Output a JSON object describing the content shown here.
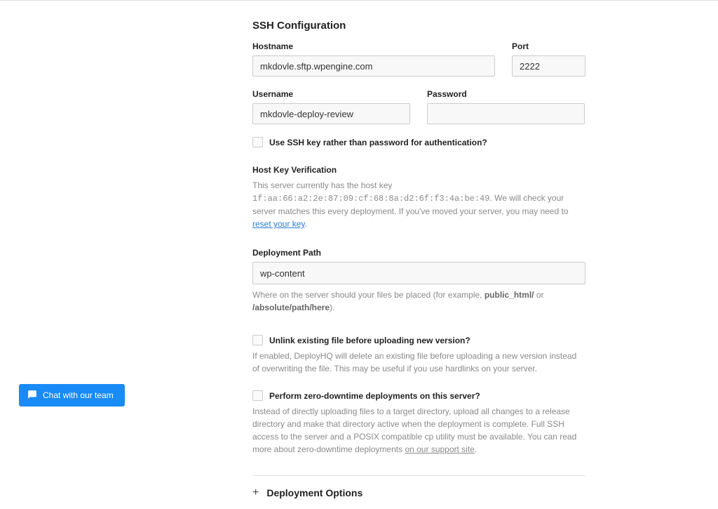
{
  "section": {
    "heading": "SSH Configuration"
  },
  "hostname": {
    "label": "Hostname",
    "value": "mkdovle.sftp.wpengine.com"
  },
  "port": {
    "label": "Port",
    "value": "2222"
  },
  "username": {
    "label": "Username",
    "value": "mkdovle-deploy-review"
  },
  "password": {
    "label": "Password",
    "value": ""
  },
  "ssh_key_checkbox": {
    "label": "Use SSH key rather than password for authentication?"
  },
  "host_key": {
    "heading": "Host Key Verification",
    "prefix": "This server currently has the host key ",
    "fingerprint": "1f:aa:66:a2:2e:87:09:cf:68:8a:d2:6f:f3:4a:be:49",
    "mid": ". We will check your server matches this every deployment. If you've moved your server, you may need to ",
    "link": "reset your key",
    "suffix": "."
  },
  "deployment_path": {
    "label": "Deployment Path",
    "value": "wp-content",
    "help_prefix": "Where on the server should your files be placed (for example, ",
    "help_strong": "public_html/",
    "help_mid": " or ",
    "help_strong2": "/absolute/path/here",
    "help_suffix": ")."
  },
  "unlink_checkbox": {
    "label": "Unlink existing file before uploading new version?",
    "help": "If enabled, DeployHQ will delete an existing file before uploading a new version instead of overwriting the file. This may be useful if you use hardlinks on your server."
  },
  "zero_checkbox": {
    "label": "Perform zero-downtime deployments on this server?",
    "help_prefix": "Instead of directly uploading files to a target directory, upload all changes to a release directory and make that directory active when the deployment is complete. Full SSH access to the server and a POSIX compatible cp utility must be available. You can read more about zero-downtime deployments ",
    "help_link": "on our support site",
    "help_suffix": "."
  },
  "deployment_options": {
    "label": "Deployment Options"
  },
  "chat": {
    "label": "Chat with our team"
  }
}
